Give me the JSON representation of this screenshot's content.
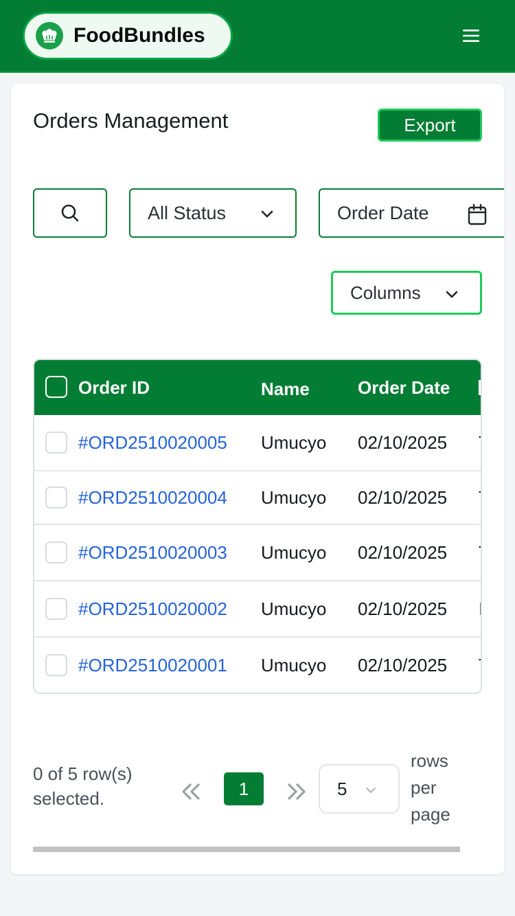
{
  "header": {
    "brand_name": "FoodBundles",
    "logo_icon": "chef-hat-icon",
    "menu_icon": "hamburger-menu-icon",
    "background_color": "#047d34"
  },
  "page": {
    "title": "Orders Management",
    "export_label": "Export"
  },
  "filters": {
    "search_icon": "search-icon",
    "status_value": "All Status",
    "date_placeholder": "Order Date",
    "columns_label": "Columns"
  },
  "table": {
    "headers": [
      "Order ID",
      "Name",
      "Order Date"
    ],
    "rows": [
      {
        "order_id": "#ORD2510020005",
        "name": "Umucyo",
        "date": "02/10/2025",
        "next": "T"
      },
      {
        "order_id": "#ORD2510020004",
        "name": "Umucyo",
        "date": "02/10/2025",
        "next": "T"
      },
      {
        "order_id": "#ORD2510020003",
        "name": "Umucyo",
        "date": "02/10/2025",
        "next": "T"
      },
      {
        "order_id": "#ORD2510020002",
        "name": "Umucyo",
        "date": "02/10/2025",
        "next": "I"
      },
      {
        "order_id": "#ORD2510020001",
        "name": "Umucyo",
        "date": "02/10/2025",
        "next": "T"
      }
    ]
  },
  "pagination": {
    "selected_text": "0 of 5 row(s) selected.",
    "current_page": "1",
    "rows_per_page_value": "5",
    "rows_per_page_label": "rows per page"
  },
  "colors": {
    "primary": "#047d34",
    "accent": "#1ec95c",
    "link": "#2563d9"
  }
}
